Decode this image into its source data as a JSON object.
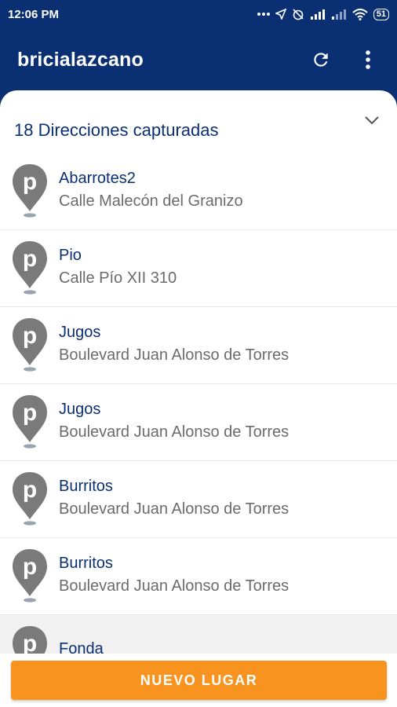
{
  "status": {
    "time": "12:06 PM",
    "battery": "51"
  },
  "app": {
    "title": "bricialazcano"
  },
  "sheet": {
    "title": "18 Direcciones capturadas"
  },
  "places": [
    {
      "name": "Abarrotes2",
      "address": "Calle Malecón del Granizo"
    },
    {
      "name": "Pio",
      "address": "Calle Pío XII 310"
    },
    {
      "name": "Jugos",
      "address": "Boulevard Juan Alonso de Torres"
    },
    {
      "name": "Jugos",
      "address": "Boulevard Juan Alonso de Torres"
    },
    {
      "name": "Burritos",
      "address": "Boulevard Juan Alonso de Torres"
    },
    {
      "name": "Burritos",
      "address": "Boulevard Juan Alonso de Torres"
    },
    {
      "name": "Fonda",
      "address": ""
    }
  ],
  "actions": {
    "new_place": "NUEVO LUGAR"
  },
  "colors": {
    "primary": "#0a2f73",
    "accent": "#f7931e",
    "pin": "#7a7a7a"
  }
}
